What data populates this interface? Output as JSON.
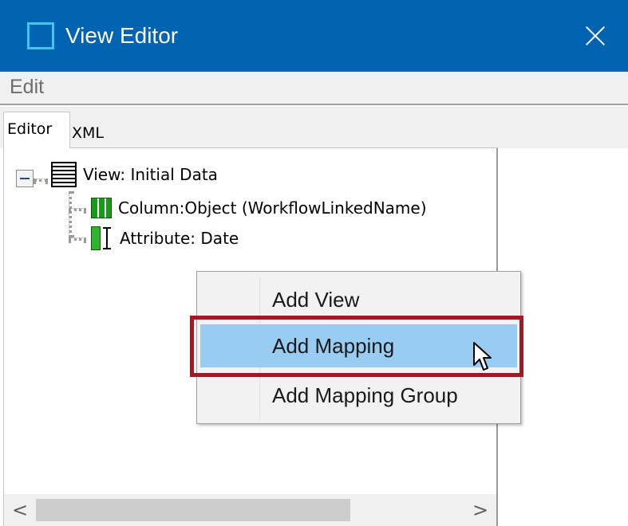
{
  "window": {
    "title": "View Editor",
    "app_icon": "window-outline-icon",
    "close_icon": "close-icon",
    "colors": {
      "titlebar": "#0063b1",
      "icon": "#3fc6e8",
      "selection": "#99ccf3",
      "highlight_border": "#9b1c24"
    }
  },
  "menubar": {
    "items": [
      {
        "label": "Edit"
      }
    ]
  },
  "tabs": [
    {
      "label": "Editor",
      "active": true
    },
    {
      "label": "XML",
      "active": false
    }
  ],
  "tree": {
    "root": {
      "label": "View: Initial Data",
      "icon": "view-table-icon",
      "expanded": true
    },
    "children": [
      {
        "label": "Column:Object (WorkflowLinkedName)",
        "icon": "column-icon"
      },
      {
        "label": "Attribute: Date",
        "icon": "attribute-icon"
      }
    ]
  },
  "context_menu": {
    "items": [
      {
        "label": "Add View"
      },
      {
        "label": "Add Mapping",
        "highlighted": true
      },
      {
        "label": "Add Mapping Group"
      }
    ]
  },
  "scrollbar": {
    "left_arrow": "<",
    "right_arrow": ">"
  }
}
